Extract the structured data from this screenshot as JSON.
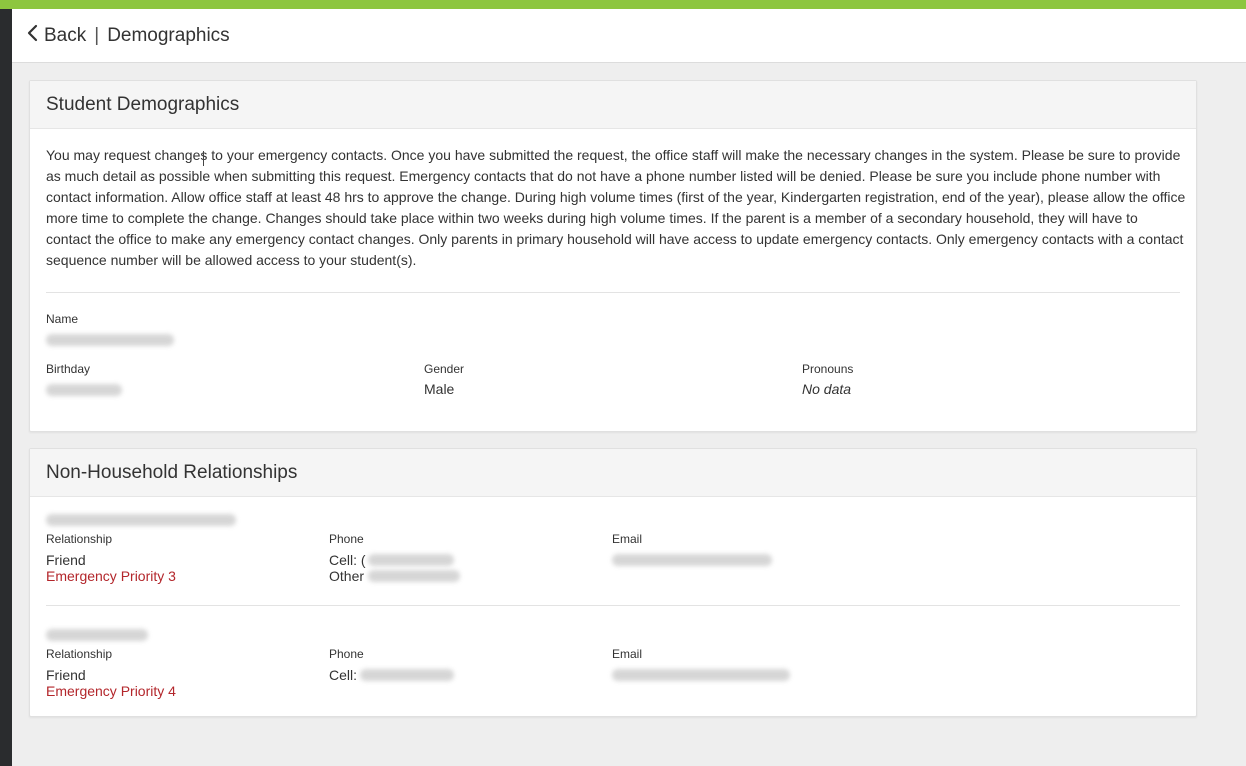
{
  "header": {
    "back_label": "Back",
    "separator": "|",
    "title": "Demographics"
  },
  "demographics": {
    "title": "Student Demographics",
    "intro": "You may request changes to your emergency contacts. Once you have submitted the request, the office staff will make the necessary changes in the system. Please be sure to provide as much detail as possible when submitting this request. Emergency contacts that do not have a phone number listed will be denied. Please be sure you include phone number with contact information. Allow office staff at least 48 hrs to approve the change. During high volume times (first of the year, Kindergarten registration, end of the year), please allow the office more time to complete the change. Changes should take place within two weeks during high volume times. If the parent is a member of a secondary household, they will have to contact the office to make any emergency contact changes. Only parents in primary household will have access to update emergency contacts. Only emergency contacts with a contact sequence number will be allowed access to your student(s).",
    "name_label": "Name",
    "birthday_label": "Birthday",
    "gender_label": "Gender",
    "gender_value": "Male",
    "pronouns_label": "Pronouns",
    "pronouns_value": "No data"
  },
  "relationships": {
    "title": "Non-Household Relationships",
    "contacts": [
      {
        "relationship_label": "Relationship",
        "relationship_value": "Friend",
        "priority": "Emergency Priority 3",
        "phone_label": "Phone",
        "phone_cell_prefix": "Cell: (",
        "phone_other_prefix": "Other",
        "email_label": "Email"
      },
      {
        "relationship_label": "Relationship",
        "relationship_value": "Friend",
        "priority": "Emergency Priority 4",
        "phone_label": "Phone",
        "phone_cell_prefix": "Cell:",
        "email_label": "Email"
      }
    ]
  },
  "colors": {
    "top_bar": "#8dc63f",
    "priority_text": "#b3262b",
    "left_rail": "#2a2c2e"
  }
}
